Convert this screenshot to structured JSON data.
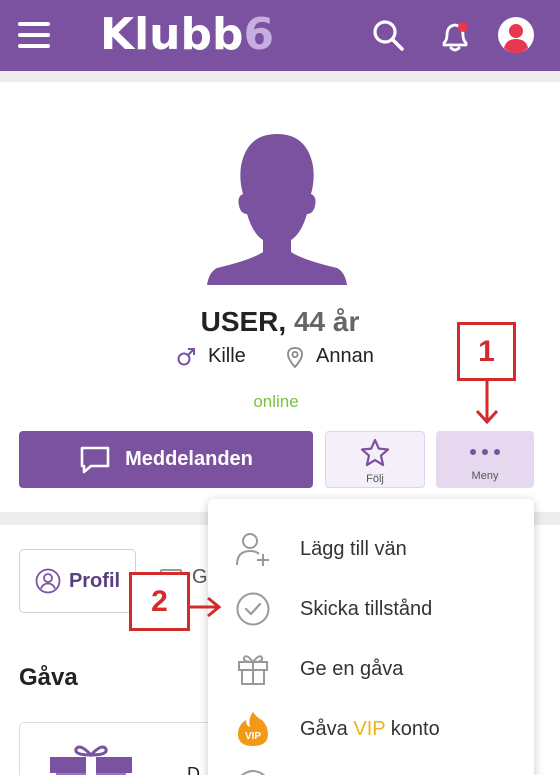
{
  "header": {
    "logo_text": "Klubb",
    "logo_digit": "6",
    "icons": [
      "menu-icon",
      "search-icon",
      "bell-icon",
      "user-avatar-icon"
    ],
    "brand_color": "#7b52a0"
  },
  "profile": {
    "username": "USER,",
    "age": "44 år",
    "gender": "Kille",
    "location": "Annan",
    "status": "online",
    "status_color": "#7ac143"
  },
  "actions": {
    "message_label": "Meddelanden",
    "follow_label": "Följ",
    "menu_label": "Meny"
  },
  "menu": {
    "items": [
      {
        "label": "Lägg till vän",
        "icon": "add-user-icon"
      },
      {
        "label": "Skicka tillstånd",
        "icon": "check-circle-icon"
      },
      {
        "label": "Ge en gåva",
        "icon": "gift-icon"
      },
      {
        "label_pre": "Gåva ",
        "label_vip": "VIP",
        "label_post": " konto",
        "icon": "vip-flame-icon"
      }
    ]
  },
  "tabs": {
    "profile_label": "Profil",
    "second_label": "G"
  },
  "gift_section": {
    "title": "Gåva",
    "partial_text": "D"
  },
  "annotations": {
    "step1": "1",
    "step2": "2",
    "color": "#d12b2b"
  }
}
